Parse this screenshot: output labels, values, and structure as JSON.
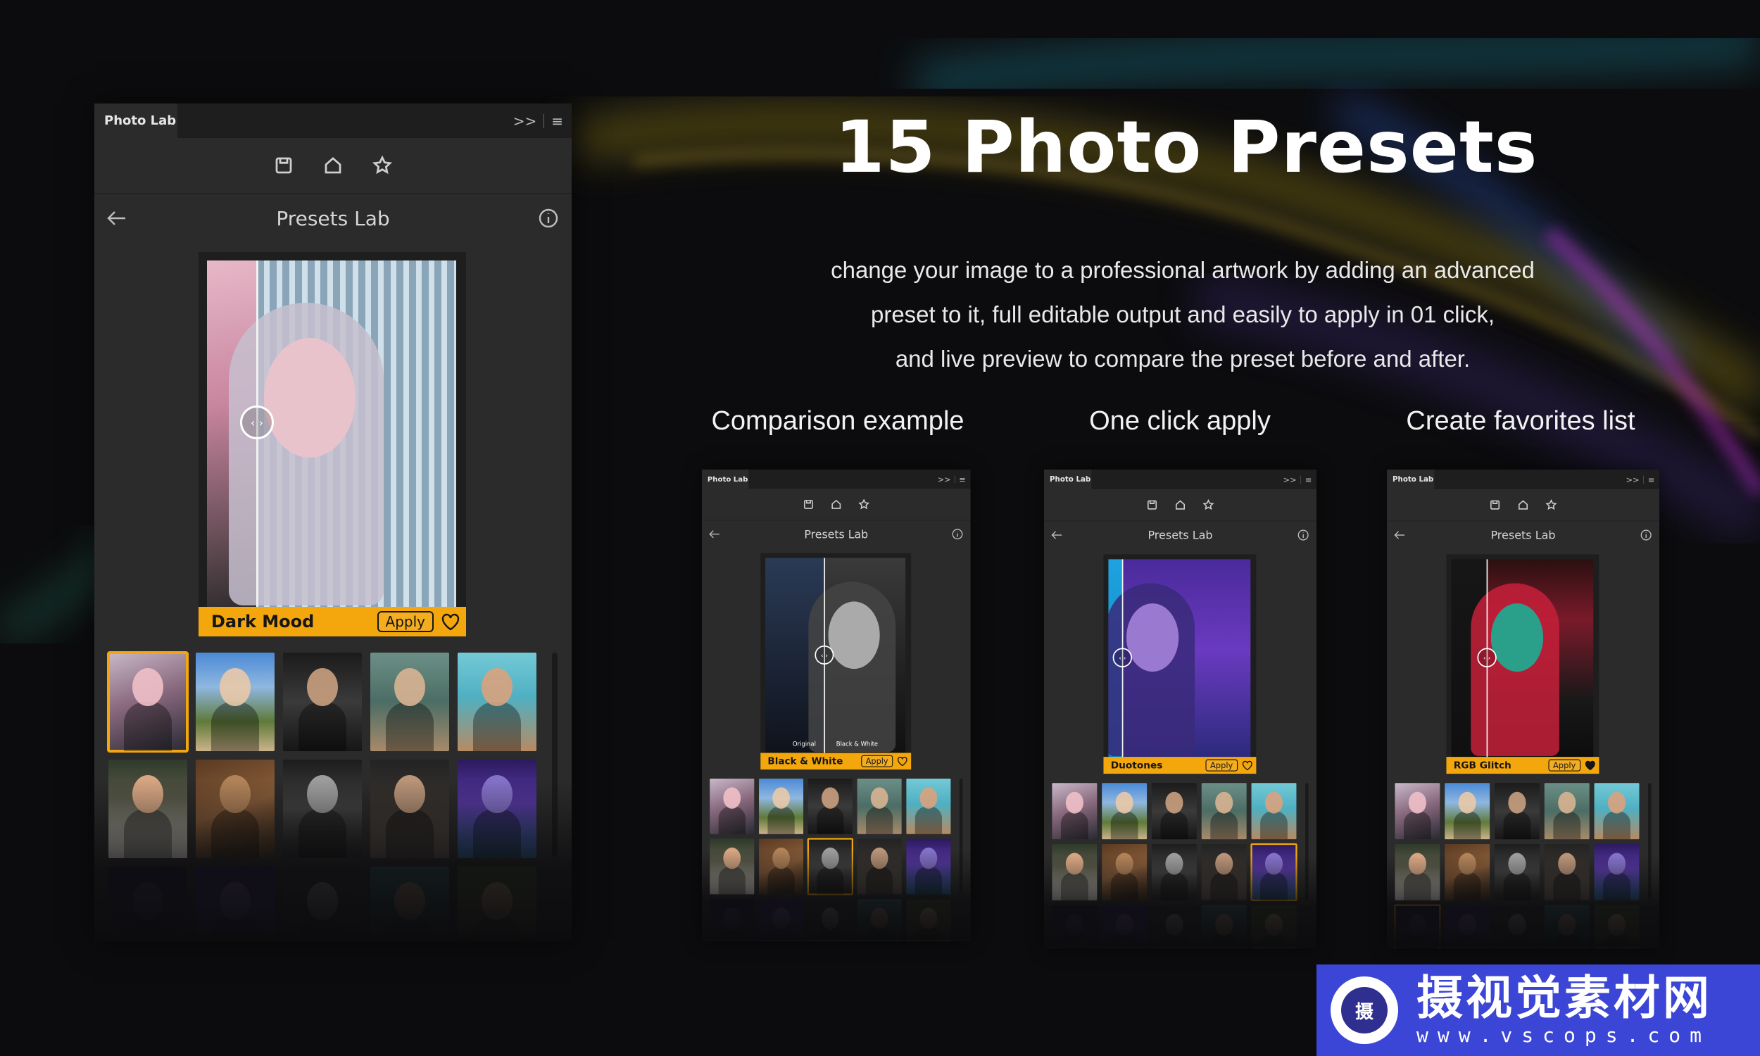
{
  "hero": {
    "title": "15 Photo Presets",
    "description_lines": [
      "change your image to a professional artwork by adding an advanced",
      "preset to it, full editable output and easily to apply in 01 click,",
      "and live preview to compare the preset before and after."
    ]
  },
  "features": [
    {
      "caption": "Comparison example"
    },
    {
      "caption": "One click apply"
    },
    {
      "caption": "Create favorites list"
    }
  ],
  "panels": [
    {
      "tab_label": "Photo Lab",
      "tab_controls": [
        ">>",
        "≡"
      ],
      "toolbar_icons": [
        "save-icon",
        "home-icon",
        "star-icon"
      ],
      "header_title": "Presets Lab",
      "preset_name": "Dark Mood",
      "apply_label": "Apply",
      "favorite": false,
      "before_label": "",
      "after_label": "",
      "selected_thumb": 0
    },
    {
      "tab_label": "Photo Lab",
      "tab_controls": [
        ">>",
        "≡"
      ],
      "toolbar_icons": [
        "save-icon",
        "home-icon",
        "star-icon"
      ],
      "header_title": "Presets Lab",
      "preset_name": "Black & White",
      "apply_label": "Apply",
      "favorite": false,
      "before_label": "Original",
      "after_label": "Black & White",
      "selected_thumb": 7
    },
    {
      "tab_label": "Photo Lab",
      "tab_controls": [
        ">>",
        "≡"
      ],
      "toolbar_icons": [
        "save-icon",
        "home-icon",
        "star-icon"
      ],
      "header_title": "Presets Lab",
      "preset_name": "Duotones",
      "apply_label": "Apply",
      "favorite": false,
      "before_label": "",
      "after_label": "",
      "selected_thumb": 9
    },
    {
      "tab_label": "Photo Lab",
      "tab_controls": [
        ">>",
        "≡"
      ],
      "toolbar_icons": [
        "save-icon",
        "home-icon",
        "star-icon"
      ],
      "header_title": "Presets Lab",
      "preset_name": "RGB Glitch",
      "apply_label": "Apply",
      "favorite": true,
      "before_label": "",
      "after_label": "",
      "selected_thumb": 10
    }
  ],
  "watermark": {
    "logo_char": "摄",
    "name": "摄视觉素材网",
    "url": "www.vscops.com"
  },
  "colors": {
    "accent": "#f4a70c",
    "panel_bg": "#2b2b2b",
    "tabbar_bg": "#1e1e1e",
    "page_bg": "#0c0c0e",
    "watermark_bg": "#3c46d6"
  }
}
